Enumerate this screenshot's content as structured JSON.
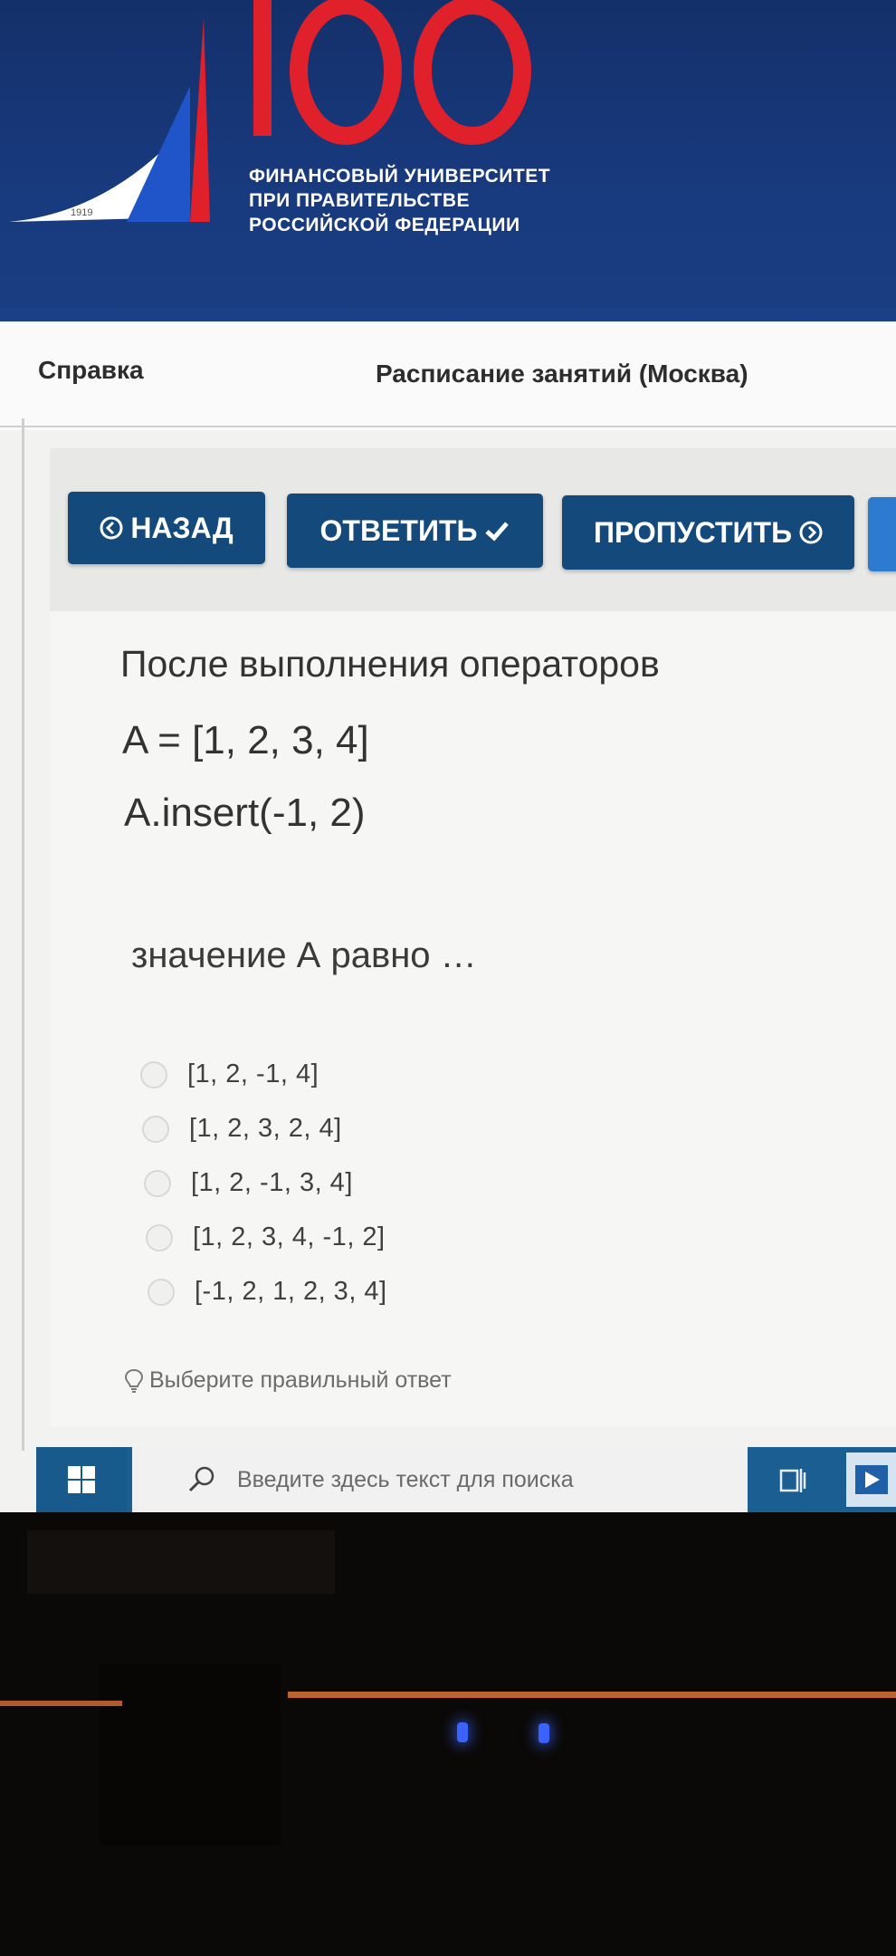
{
  "header": {
    "logo_number": "100",
    "logo_year": "1919",
    "university_lines": [
      "ФИНАНСОВЫЙ УНИВЕРСИТЕТ",
      "ПРИ ПРАВИТЕЛЬСТВЕ",
      "РОССИЙСКОЙ ФЕДЕРАЦИИ"
    ]
  },
  "nav": {
    "help_label": "Справка",
    "schedule_label": "Расписание занятий (Москва)"
  },
  "toolbar": {
    "back_label": "НАЗАД",
    "answer_label": "ОТВЕТИТЬ",
    "skip_label": "ПРОПУСТИТЬ"
  },
  "question": {
    "lines": [
      "После выполнения операторов",
      "A = [1, 2, 3, 4]",
      "A.insert(-1, 2)",
      "значение А равно …"
    ],
    "options": [
      "[1, 2, -1, 4]",
      "[1, 2, 3, 2, 4]",
      "[1, 2, -1, 3, 4]",
      "[1, 2, 3, 4, -1, 2]",
      "[-1, 2, 1, 2, 3, 4]"
    ],
    "hint": "Выберите правильный ответ"
  },
  "taskbar": {
    "search_placeholder": "Введите здесь текст для поиска"
  },
  "colors": {
    "header_blue": "#183a7e",
    "logo_red": "#e0202a",
    "button_blue": "#14497c",
    "taskbar_blue": "#1b5f92",
    "led_blue": "#3b62ff"
  },
  "icons": {
    "back": "circle-left-arrow-icon",
    "answer": "checkmark-icon",
    "skip": "circle-right-arrow-icon",
    "hint": "lightbulb-icon",
    "start": "windows-logo-icon",
    "search": "search-icon",
    "task_view": "task-view-icon",
    "app": "media-player-icon"
  }
}
